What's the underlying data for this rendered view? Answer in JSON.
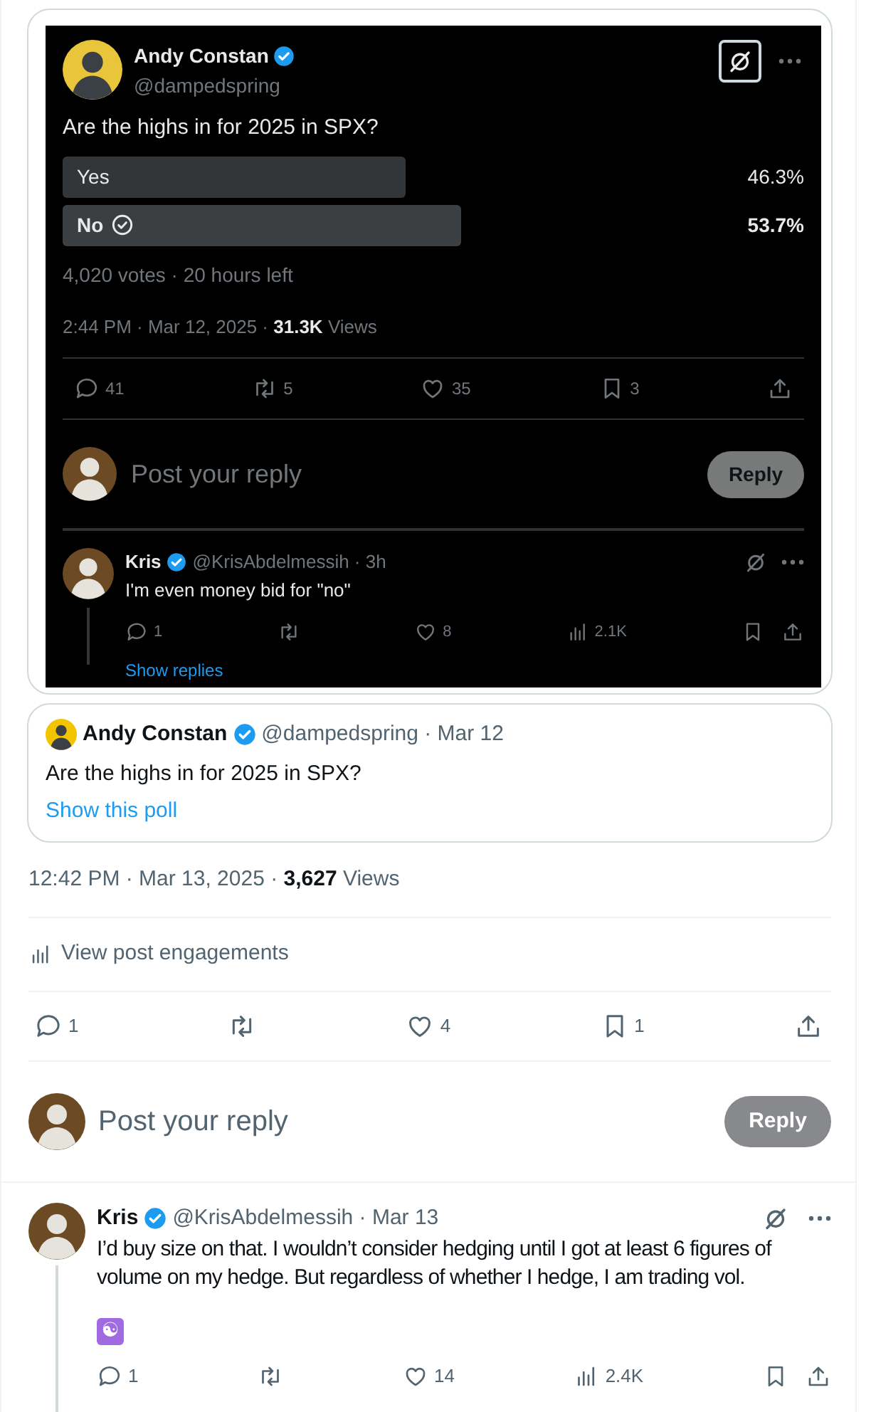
{
  "embedded_screenshot": {
    "author": {
      "name": "Andy Constan",
      "handle": "@dampedspring"
    },
    "question": "Are the highs in for 2025 in SPX?",
    "poll": {
      "options": [
        {
          "label": "Yes",
          "percent": "46.3%",
          "selected": false
        },
        {
          "label": "No",
          "percent": "53.7%",
          "selected": true
        }
      ],
      "summary": "4,020 votes · 20 hours left"
    },
    "timestamp": "2:44 PM · Mar 12, 2025 · **31.3K** Views",
    "actions": [
      {
        "kind": "reply",
        "count": "41"
      },
      {
        "kind": "repost",
        "count": "5"
      },
      {
        "kind": "like",
        "count": "35"
      },
      {
        "kind": "bookmark",
        "count": "3"
      },
      {
        "kind": "share"
      }
    ],
    "reply_box": {
      "placeholder": "Post your reply",
      "button": "Reply"
    },
    "reply": {
      "name": "Kris",
      "handle": "@KrisAbdelmessih · 3h",
      "text": "I'm even money bid for \"no\"",
      "actions": [
        {
          "kind": "reply",
          "count": "1"
        },
        {
          "kind": "repost"
        },
        {
          "kind": "like",
          "count": "8"
        },
        {
          "kind": "views",
          "count": "2.1K"
        },
        {
          "kind": "bookmark"
        },
        {
          "kind": "share"
        }
      ],
      "show_replies": "Show replies"
    }
  },
  "quoted_post": {
    "name": "Andy Constan",
    "handle": "@dampedspring · Mar 12",
    "text": "Are the highs in for 2025 in SPX?",
    "link": "Show this poll"
  },
  "timestamp": "12:42 PM · Mar 13, 2025 · **3,627** Views",
  "engagements_link": "View post engagements",
  "actions": [
    {
      "kind": "reply",
      "count": "1"
    },
    {
      "kind": "repost"
    },
    {
      "kind": "like",
      "count": "4"
    },
    {
      "kind": "bookmark",
      "count": "1"
    },
    {
      "kind": "share"
    }
  ],
  "reply_box": {
    "placeholder": "Post your reply",
    "button": "Reply"
  },
  "reply": {
    "name": "Kris",
    "handle": "@KrisAbdelmessih · Mar 13",
    "text": "I’d buy size on that. I wouldn’t consider hedging until I got at least 6 figures of volume on my hedge. But regardless of whether I hedge, I am trading vol.",
    "emoji": "☯",
    "actions": [
      {
        "kind": "reply",
        "count": "1"
      },
      {
        "kind": "repost"
      },
      {
        "kind": "like",
        "count": "14"
      },
      {
        "kind": "views",
        "count": "2.4K"
      },
      {
        "kind": "bookmark"
      },
      {
        "kind": "share"
      }
    ]
  }
}
